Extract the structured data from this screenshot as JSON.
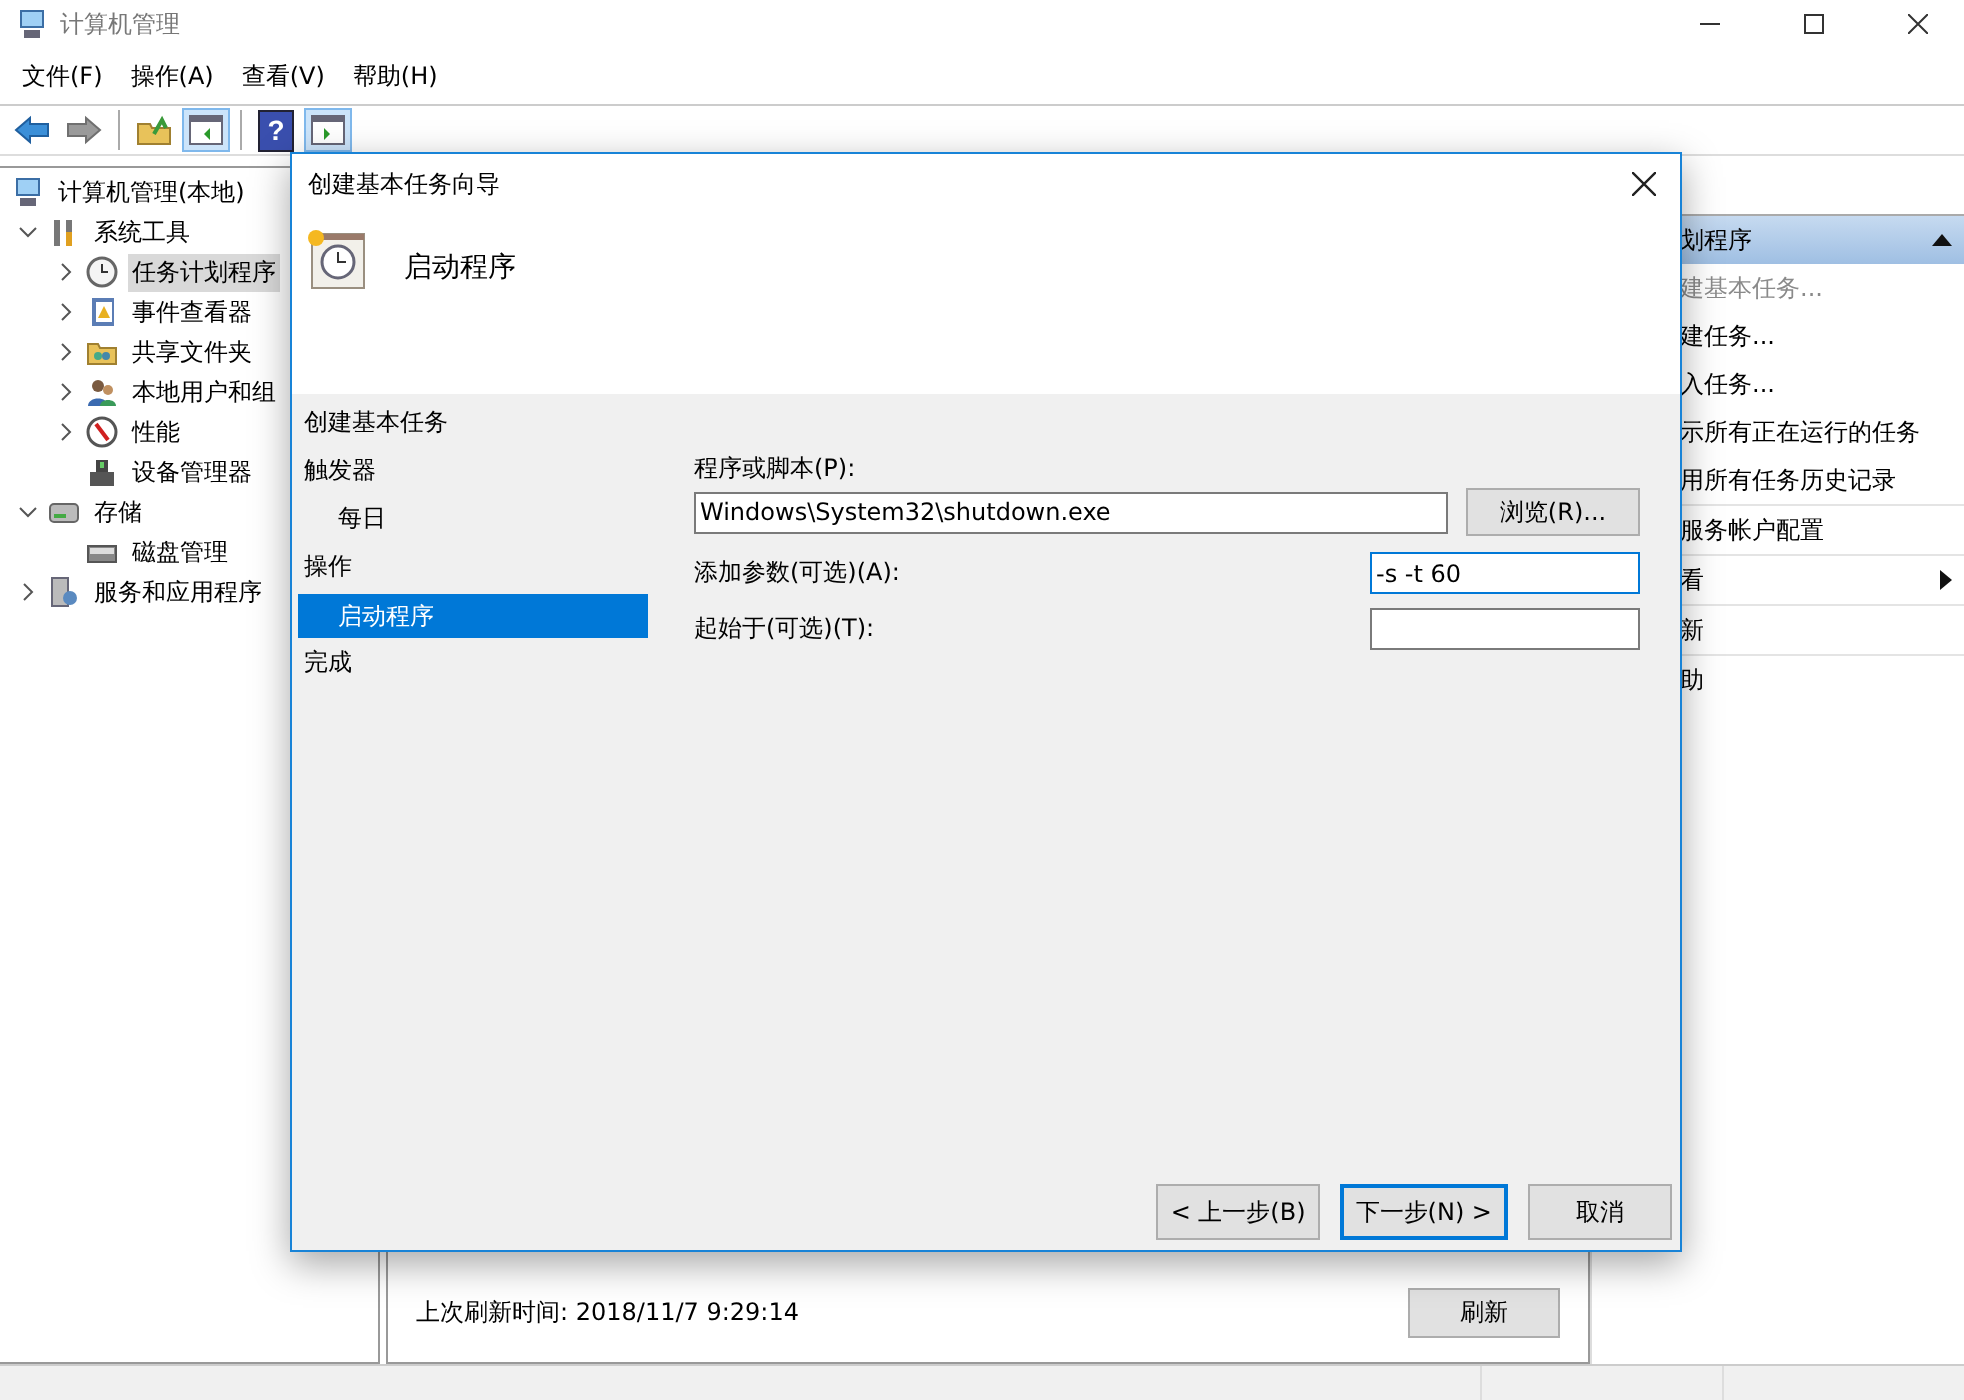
{
  "window": {
    "title": "计算机管理"
  },
  "menu": [
    "文件(F)",
    "操作(A)",
    "查看(V)",
    "帮助(H)"
  ],
  "toolbar": [
    {
      "kind": "back",
      "highlighted": false
    },
    {
      "kind": "forward",
      "highlighted": false
    },
    {
      "kind": "separator"
    },
    {
      "kind": "up",
      "highlighted": false
    },
    {
      "kind": "pane",
      "highlighted": true
    },
    {
      "kind": "separator"
    },
    {
      "kind": "help",
      "label": "?",
      "highlighted": false
    },
    {
      "kind": "pane-right",
      "highlighted": true
    }
  ],
  "tree": [
    {
      "label": "计算机管理(本地)",
      "kind": "computer",
      "selected": false,
      "children": [
        {
          "label": "系统工具",
          "kind": "tools",
          "expanded": true,
          "selected": false,
          "children": [
            {
              "label": "任务计划程序",
              "kind": "clock",
              "expanded": false,
              "selected": true
            },
            {
              "label": "事件查看器",
              "kind": "log",
              "expanded": false,
              "selected": false
            },
            {
              "label": "共享文件夹",
              "kind": "folder",
              "expanded": false,
              "selected": false
            },
            {
              "label": "本地用户和组",
              "kind": "users",
              "expanded": false,
              "selected": false
            },
            {
              "label": "性能",
              "kind": "gauge",
              "expanded": false,
              "selected": false
            },
            {
              "label": "设备管理器",
              "kind": "device",
              "selected": false
            }
          ]
        },
        {
          "label": "存储",
          "kind": "storage",
          "expanded": true,
          "selected": false,
          "children": [
            {
              "label": "磁盘管理",
              "kind": "disk",
              "selected": false
            }
          ]
        },
        {
          "label": "服务和应用程序",
          "kind": "services",
          "expanded": false,
          "selected": false
        }
      ]
    }
  ],
  "center": {
    "refresh_info": "上次刷新时间: 2018/11/7 9:29:14",
    "refresh_button": "刷新"
  },
  "actions": {
    "header": "划程序",
    "items": [
      {
        "label": "建基本任务...",
        "disabled": true,
        "submenu": false,
        "divider": false
      },
      {
        "label": "建任务...",
        "disabled": false,
        "submenu": false,
        "divider": false
      },
      {
        "label": "入任务...",
        "disabled": false,
        "submenu": false,
        "divider": false
      },
      {
        "label": "示所有正在运行的任务",
        "disabled": false,
        "submenu": false,
        "divider": false
      },
      {
        "label": "用所有任务历史记录",
        "disabled": false,
        "submenu": false,
        "divider": true
      },
      {
        "label": "服务帐户配置",
        "disabled": false,
        "submenu": false,
        "divider": true
      },
      {
        "label": "看",
        "disabled": false,
        "submenu": true,
        "divider": true
      },
      {
        "label": "新",
        "disabled": false,
        "submenu": false,
        "divider": true
      },
      {
        "label": "助",
        "disabled": false,
        "submenu": false,
        "divider": false
      }
    ]
  },
  "dialog": {
    "title": "创建基本任务向导",
    "heading": "启动程序",
    "steps": [
      {
        "label": "创建基本任务",
        "selected": false
      },
      {
        "label": "触发器",
        "selected": false,
        "children": [
          {
            "label": "每日",
            "selected": false
          }
        ]
      },
      {
        "label": "操作",
        "selected": false,
        "children": [
          {
            "label": "启动程序",
            "selected": true
          }
        ]
      },
      {
        "label": "完成",
        "selected": false
      }
    ],
    "program": {
      "label": "程序或脚本(P):",
      "value": "Windows\\System32\\shutdown.exe",
      "browse": "浏览(R)..."
    },
    "arguments": {
      "label": "添加参数(可选)(A):",
      "value": "-s -t 60",
      "focused": true
    },
    "start_in": {
      "label": "起始于(可选)(T):",
      "focused": false
    },
    "buttons": [
      {
        "label": "< 上一步(B)",
        "default": false
      },
      {
        "label": "下一步(N) >",
        "default": true
      },
      {
        "label": "取消",
        "default": false
      }
    ]
  }
}
